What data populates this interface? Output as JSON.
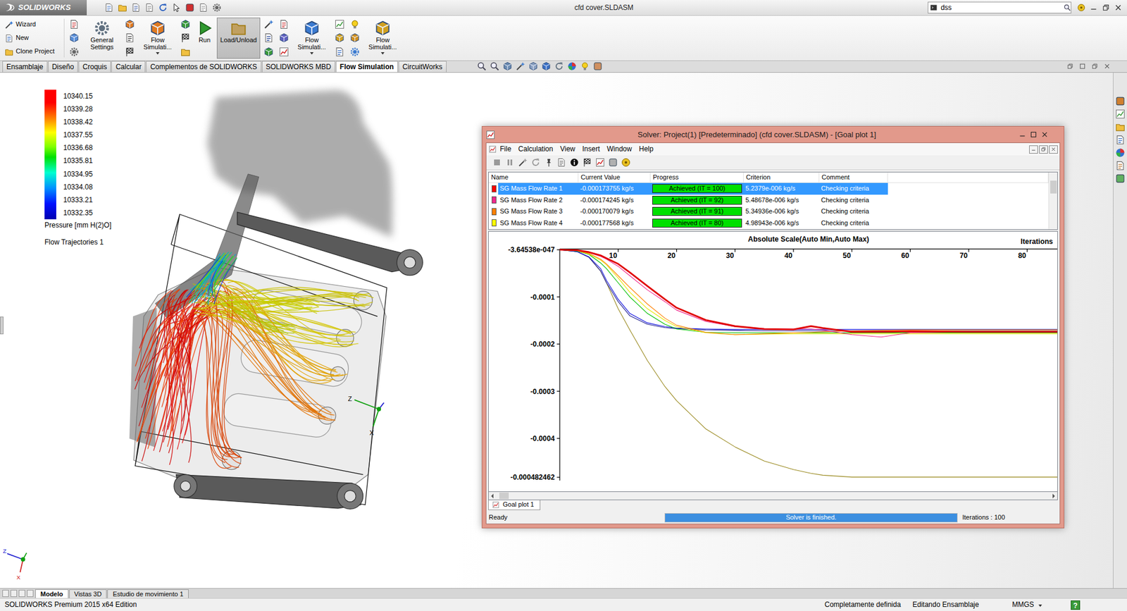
{
  "app": {
    "logo": "SOLIDWORKS",
    "title": "cfd cover.SLDASM",
    "search": {
      "value": "dss"
    }
  },
  "ribbon": {
    "list": [
      {
        "label": "Wizard"
      },
      {
        "label": "New"
      },
      {
        "label": "Clone Project"
      }
    ],
    "buttons": [
      {
        "label": "General Settings",
        "pressed": false,
        "dropdown": false
      },
      {
        "label": "Flow Simulati...",
        "pressed": false,
        "dropdown": true
      },
      {
        "label": "Run",
        "pressed": false,
        "dropdown": false
      },
      {
        "label": "Load/Unload",
        "pressed": true,
        "dropdown": false
      },
      {
        "label": "Flow Simulati...",
        "pressed": false,
        "dropdown": true
      },
      {
        "label": "Flow Simulati...",
        "pressed": false,
        "dropdown": true
      }
    ]
  },
  "tabs": [
    {
      "label": "Ensamblaje",
      "selected": false
    },
    {
      "label": "Diseño",
      "selected": false
    },
    {
      "label": "Croquis",
      "selected": false
    },
    {
      "label": "Calcular",
      "selected": false
    },
    {
      "label": "Complementos de SOLIDWORKS",
      "selected": false
    },
    {
      "label": "SOLIDWORKS MBD",
      "selected": false
    },
    {
      "label": "Flow Simulation",
      "selected": true
    },
    {
      "label": "CircuitWorks",
      "selected": false
    }
  ],
  "legend": {
    "values": [
      "10340.15",
      "10339.28",
      "10338.42",
      "10337.55",
      "10336.68",
      "10335.81",
      "10334.95",
      "10334.08",
      "10333.21",
      "10332.35"
    ],
    "quantity": "Pressure [mm H(2)O]",
    "feature": "Flow Trajectories 1"
  },
  "triads": {
    "view": [
      "Z",
      "X"
    ],
    "corner": [
      "Z",
      "X"
    ]
  },
  "solver": {
    "title": "Solver: Project(1) [Predeterminado] (cfd cover.SLDASM) - [Goal plot 1]",
    "menu": [
      "File",
      "Calculation",
      "View",
      "Insert",
      "Window",
      "Help"
    ],
    "columns": [
      "Name",
      "Current Value",
      "Progress",
      "Criterion",
      "Comment"
    ],
    "goals": [
      {
        "name": "SG Mass Flow Rate 1",
        "value": "-0.000173755 kg/s",
        "progress": "Achieved (IT = 100)",
        "level": 1,
        "criterion": "5.2379e-006 kg/s",
        "comment": "Checking criteria",
        "color": "#ff0000",
        "selected": true
      },
      {
        "name": "SG Mass Flow Rate 2",
        "value": "-0.000174245 kg/s",
        "progress": "Achieved (IT = 92)",
        "level": 1,
        "criterion": "5.48678e-006 kg/s",
        "comment": "Checking criteria",
        "color": "#f0288c",
        "selected": false
      },
      {
        "name": "SG Mass Flow Rate 3",
        "value": "-0.000170079 kg/s",
        "progress": "Achieved (IT = 91)",
        "level": 1,
        "criterion": "5.34936e-006 kg/s",
        "comment": "Checking criteria",
        "color": "#ff8000",
        "selected": false
      },
      {
        "name": "SG Mass Flow Rate 4",
        "value": "-0.000177568 kg/s",
        "progress": "Achieved (IT = 80)",
        "level": 1,
        "criterion": "4.98943e-006 kg/s",
        "comment": "Checking criteria",
        "color": "#ffff00",
        "selected": false
      }
    ],
    "chart": {
      "title": "Absolute Scale(Auto Min,Auto Max)",
      "x_label": "Iterations",
      "x_ticks": [
        "10",
        "20",
        "30",
        "40",
        "50",
        "60",
        "70",
        "80"
      ],
      "y_ticks": [
        "-3.64538e-047",
        "-0.0001",
        "-0.0002",
        "-0.0003",
        "-0.0004",
        "-0.000482462"
      ],
      "iterations": [
        0,
        3,
        5,
        7,
        8,
        10,
        12,
        15,
        18,
        20,
        25,
        30,
        35,
        40,
        43,
        45,
        50,
        55,
        60,
        70,
        80,
        86
      ],
      "series": [
        {
          "color": "#9a8a20",
          "bold": false,
          "values": [
            0,
            -4e-06,
            -1.6e-05,
            -4.5e-05,
            -7e-05,
            -0.000125,
            -0.00017,
            -0.000235,
            -0.00029,
            -0.00032,
            -0.00038,
            -0.000418,
            -0.000448,
            -0.000466,
            -0.000474,
            -0.000478,
            -0.000482,
            -0.000482,
            -0.000482,
            -0.000482,
            -0.000482,
            -0.000482
          ]
        },
        {
          "color": "#202090",
          "bold": false,
          "values": [
            0,
            -4e-06,
            -1.6e-05,
            -4.5e-05,
            -7e-05,
            -0.00011,
            -0.00014,
            -0.000158,
            -0.000165,
            -0.000167,
            -0.00017,
            -0.000171,
            -0.000172,
            -0.000172,
            -0.000172,
            -0.000172,
            -0.000172,
            -0.000172,
            -0.000172,
            -0.000172,
            -0.000172,
            -0.000172
          ]
        },
        {
          "color": "#1010e0",
          "bold": false,
          "values": [
            0,
            -4e-06,
            -1.5e-05,
            -4e-05,
            -6.5e-05,
            -0.000105,
            -0.000135,
            -0.000155,
            -0.000163,
            -0.000166,
            -0.000168,
            -0.000169,
            -0.000169,
            -0.000169,
            -0.000169,
            -0.000169,
            -0.000169,
            -0.000169,
            -0.000169,
            -0.000169,
            -0.000169,
            -0.000169
          ]
        },
        {
          "color": "#00c000",
          "bold": false,
          "values": [
            0,
            -3e-06,
            -1e-05,
            -2.8e-05,
            -4e-05,
            -7e-05,
            -0.0001,
            -0.000135,
            -0.000158,
            -0.000168,
            -0.000175,
            -0.000176,
            -0.000176,
            -0.000176,
            -0.000176,
            -0.000176,
            -0.000176,
            -0.000176,
            -0.000176,
            -0.000176,
            -0.000176,
            -0.000176
          ]
        },
        {
          "color": "#e8e800",
          "bold": false,
          "values": [
            0,
            -2e-06,
            -9e-06,
            -2.2e-05,
            -3.2e-05,
            -6e-05,
            -9e-05,
            -0.000125,
            -0.00015,
            -0.000163,
            -0.000176,
            -0.00018,
            -0.000179,
            -0.000178,
            -0.000178,
            -0.000178,
            -0.000178,
            -0.000178,
            -0.000178,
            -0.000178,
            -0.000178,
            -0.000178
          ]
        },
        {
          "color": "#ff8000",
          "bold": false,
          "values": [
            0,
            -2e-06,
            -8e-06,
            -2e-05,
            -3e-05,
            -5.5e-05,
            -8e-05,
            -0.000115,
            -0.000145,
            -0.00016,
            -0.000175,
            -0.00018,
            -0.000178,
            -0.000176,
            -0.000175,
            -0.000174,
            -0.000172,
            -0.000171,
            -0.00017,
            -0.00017,
            -0.00017,
            -0.00017
          ]
        },
        {
          "color": "#f0288c",
          "bold": false,
          "values": [
            0,
            -1e-06,
            -6e-06,
            -1.4e-05,
            -2e-05,
            -3.5e-05,
            -5.5e-05,
            -8.5e-05,
            -0.00011,
            -0.000128,
            -0.000152,
            -0.000163,
            -0.000167,
            -0.000168,
            -0.000168,
            -0.00017,
            -0.00018,
            -0.000185,
            -0.000176,
            -0.000174,
            -0.000174,
            -0.000174
          ]
        },
        {
          "color": "#e00000",
          "bold": true,
          "values": [
            0,
            -1e-06,
            -5e-06,
            -1.2e-05,
            -1.8e-05,
            -3e-05,
            -4.8e-05,
            -7.7e-05,
            -0.000105,
            -0.000123,
            -0.000149,
            -0.000162,
            -0.000168,
            -0.000169,
            -0.000162,
            -0.000166,
            -0.000174,
            -0.000174,
            -0.000173,
            -0.000174,
            -0.000174,
            -0.000174
          ]
        }
      ]
    },
    "tabs": [
      {
        "label": "Goal plot 1",
        "selected": true
      }
    ],
    "status": {
      "left": "Ready",
      "progress": "Solver is finished.",
      "level": 1,
      "right": "Iterations : 100"
    }
  },
  "bottom_tabs": [
    {
      "label": "Modelo",
      "selected": true
    },
    {
      "label": "Vistas 3D",
      "selected": false
    },
    {
      "label": "Estudio de movimiento 1",
      "selected": false
    }
  ],
  "status_bar": {
    "edition": "SOLIDWORKS Premium 2015 x64 Edition",
    "state": "Completamente definida",
    "mode": "Editando Ensamblaje",
    "units": "MMGS",
    "help": "?"
  }
}
